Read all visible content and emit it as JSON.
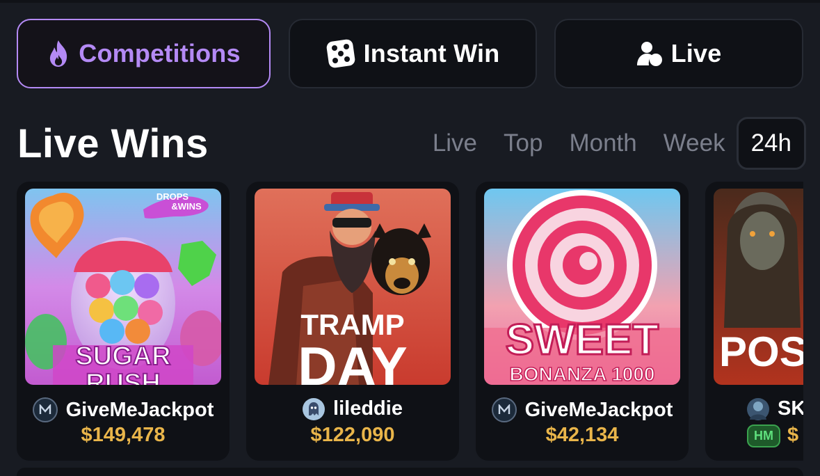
{
  "nav": {
    "competitions": "Competitions",
    "instant_win": "Instant Win",
    "live": "Live"
  },
  "live_wins": {
    "title": "Live Wins",
    "tabs": [
      "Live",
      "Top",
      "Month",
      "Week",
      "24h"
    ],
    "active_tab": "24h"
  },
  "cards": [
    {
      "game_title_line1": "SUGAR",
      "game_title_line2": "RUSH",
      "game_badge": "DROPS & WINS",
      "username": "GiveMeJackpot",
      "amount": "$149,478"
    },
    {
      "game_title_line1": "TRAMP",
      "game_title_line2": "DAY",
      "username": "lileddie",
      "amount": "$122,090"
    },
    {
      "game_title_line1": "SWEET",
      "game_title_line2": "BONANZA 1000",
      "username": "GiveMeJackpot",
      "amount": "$42,134"
    },
    {
      "game_title_line1": "POSS",
      "username": "SK",
      "badge": "HM",
      "amount": "$"
    }
  ],
  "colors": {
    "accent": "#b48af5",
    "amount": "#e9b54a",
    "background": "#181b22",
    "card": "#0f1116"
  }
}
